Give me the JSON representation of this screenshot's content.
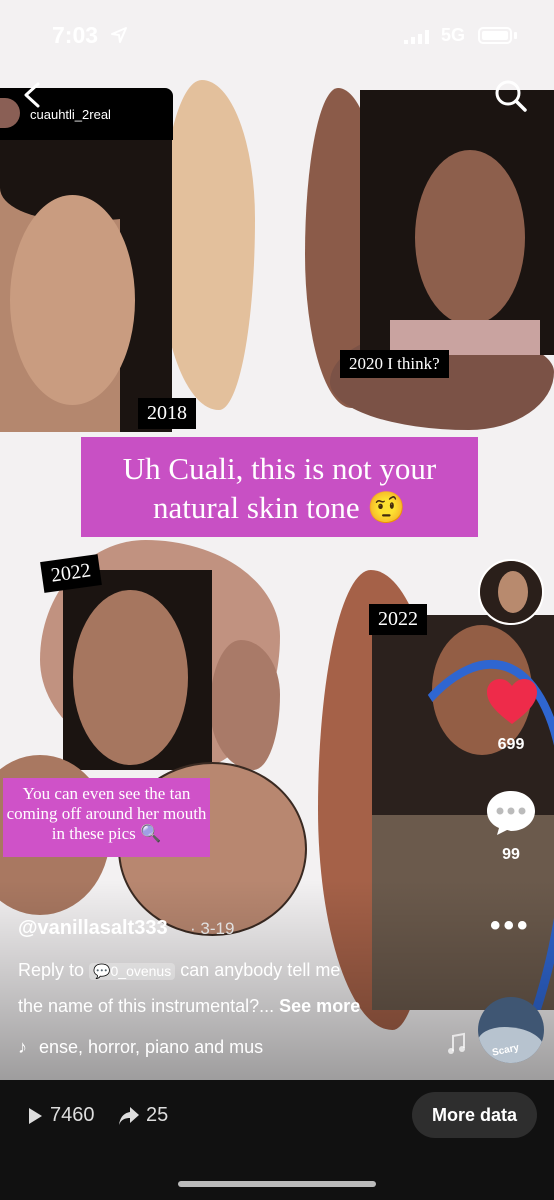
{
  "status_bar": {
    "time": "7:03",
    "network": "5G"
  },
  "overlay": {
    "handle": "cuauhtli_2real",
    "year_tags": [
      "2018",
      "2020 I think?",
      "2022",
      "2022"
    ],
    "banner_text": "Uh Cuali, this is not your natural skin tone 🤨",
    "pink_note": "You can even see the tan coming off around her mouth in these pics 🔍"
  },
  "rail": {
    "likes": "699",
    "comments": "99",
    "disc_label": "Scary"
  },
  "caption": {
    "username": "@vanillasalt333",
    "date": "· 3-19",
    "reply_prefix": "Reply to",
    "reply_user": "💬0_ovenus",
    "reply_text": "can anybody tell me",
    "line2": "the name of this instrumental?...",
    "see_more": "See more",
    "music": "ense, horror, piano and mus"
  },
  "bottom_bar": {
    "plays": "7460",
    "shares": "25",
    "more_data_label": "More data"
  },
  "colors": {
    "banner": "#c850c4",
    "heart": "#ee2b4a"
  }
}
